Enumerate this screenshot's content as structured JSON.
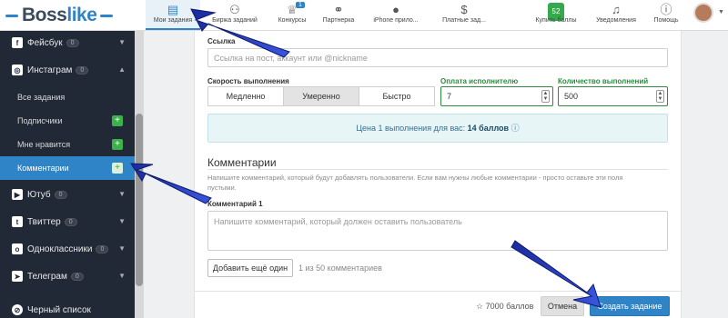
{
  "logo": {
    "part1": "Boss",
    "part2": "like"
  },
  "nav": [
    {
      "icon": "clipboard-icon",
      "glyph": "📋",
      "label": "Мои задания"
    },
    {
      "icon": "users-icon",
      "glyph": "👥",
      "label": "Биржа заданий"
    },
    {
      "icon": "trophy-icon",
      "glyph": "🏆",
      "label": "Конкурсы",
      "badge": "1"
    },
    {
      "icon": "handshake-icon",
      "glyph": "🤝",
      "label": "Партнерка"
    },
    {
      "icon": "apple-icon",
      "glyph": "",
      "label": "iPhone прило..."
    },
    {
      "icon": "money-icon",
      "glyph": "💲",
      "label": "Платные зад..."
    },
    {
      "icon": "cart-icon",
      "glyph": "",
      "label": "Купить баллы",
      "badge": "52"
    },
    {
      "icon": "bell-icon",
      "glyph": "🔔",
      "label": "Уведомления"
    },
    {
      "icon": "question-icon",
      "glyph": "?",
      "label": "Помощь"
    }
  ],
  "sidebar": {
    "facebook": {
      "label": "Фейсбук",
      "count": "0"
    },
    "instagram": {
      "label": "Инстаграм",
      "count": "0"
    },
    "sub": [
      {
        "label": "Все задания"
      },
      {
        "label": "Подписчики",
        "plus": "+"
      },
      {
        "label": "Мне нравится",
        "plus": "+"
      },
      {
        "label": "Комментарии",
        "plus": "+"
      }
    ],
    "youtube": {
      "label": "Ютуб",
      "count": "0"
    },
    "twitter": {
      "label": "Твиттер",
      "count": "0"
    },
    "ok": {
      "label": "Одноклассники",
      "count": "0"
    },
    "telegram": {
      "label": "Телеграм",
      "count": "0"
    },
    "blacklist": {
      "label": "Черный список"
    }
  },
  "form": {
    "link_label": "Ссылка",
    "link_placeholder": "Ссылка на пост, аккаунт или @nickname",
    "speed_label": "Скорость выполнения",
    "speed_options": [
      "Медленно",
      "Умеренно",
      "Быстро"
    ],
    "speed_selected": "Умеренно",
    "pay_label": "Оплата исполнителю",
    "pay_value": "7",
    "count_label": "Количество выполнений",
    "count_value": "500",
    "price_text": "Цена 1 выполнения для вас:",
    "price_value": "14 баллов",
    "comments_title": "Комментарии",
    "comments_help": "Напишите комментарий, который будут добавлять пользователи. Если вам нужны любые комментарии - просто оставьте эти поля пустыми.",
    "comment1_label": "Комментарий 1",
    "comment1_placeholder": "Напишите комментарий, который должен оставить пользователь",
    "add_button": "Добавить ещё один",
    "counter": "1 из 50 комментариев",
    "balance": "7000 баллов",
    "cancel": "Отмена",
    "submit": "Создать задание"
  },
  "colors": {
    "accent": "#2f84c7",
    "sidebar": "#212836",
    "green": "#36a94c",
    "arrow": "#2038b8"
  }
}
